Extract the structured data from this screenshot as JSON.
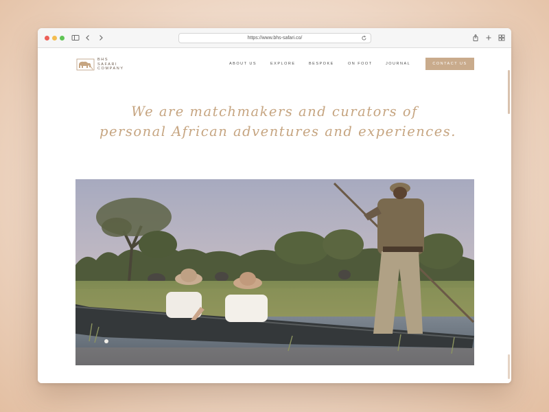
{
  "browser": {
    "url": "https://www.bhs-safari.co/",
    "toolbar_icons": [
      "sidebar-icon",
      "back-icon",
      "forward-icon",
      "reload-icon",
      "share-icon",
      "new-tab-icon",
      "tab-overview-icon"
    ]
  },
  "site": {
    "logo": {
      "lines": [
        "BHS",
        "SAFARI",
        "COMPANY"
      ]
    },
    "nav": {
      "items": [
        "ABOUT US",
        "EXPLORE",
        "BESPOKE",
        "ON FOOT",
        "JOURNAL"
      ],
      "cta": "CONTACT US"
    },
    "tagline": {
      "line1": "We are matchmakers and curators of",
      "line2": "personal African adventures and experiences."
    },
    "hero": {
      "image": "photo"
    }
  },
  "colors": {
    "accent": "#c9ab8c",
    "tagline": "#c6a581"
  }
}
